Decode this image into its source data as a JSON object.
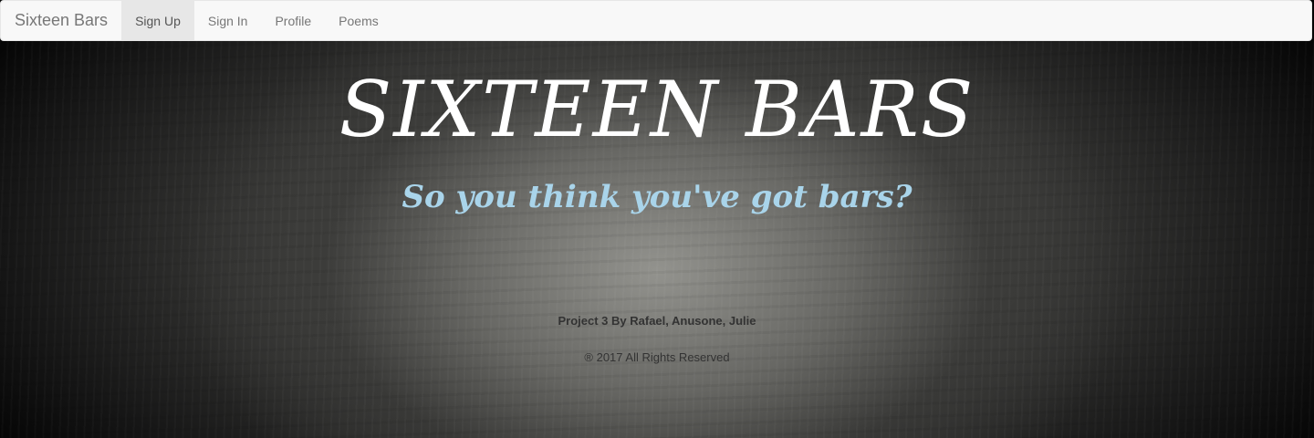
{
  "navbar": {
    "brand": "Sixteen Bars",
    "items": [
      {
        "label": "Sign Up",
        "active": true
      },
      {
        "label": "Sign In",
        "active": false
      },
      {
        "label": "Profile",
        "active": false
      },
      {
        "label": "Poems",
        "active": false
      }
    ]
  },
  "hero": {
    "title": "SIXTEEN BARS",
    "subtitle": "So you think you've got bars?"
  },
  "footer": {
    "credit": "Project 3 By Rafael, Anusone, Julie",
    "copyright": "® 2017 All Rights Reserved"
  },
  "colors": {
    "navbar_bg": "#f8f8f8",
    "subtitle": "#a9d4ea",
    "title": "#ffffff"
  }
}
